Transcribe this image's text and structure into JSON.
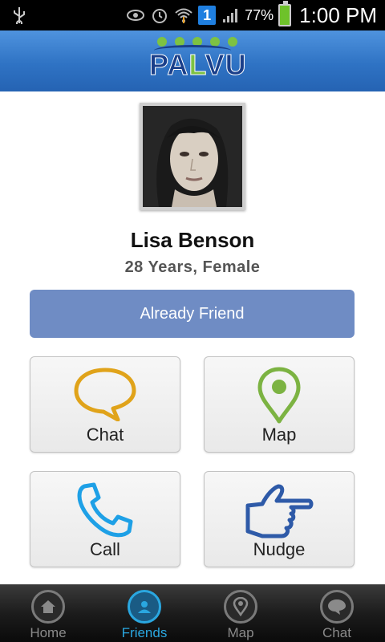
{
  "status_bar": {
    "battery_percent": "77%",
    "time": "1:00 PM",
    "notification_badge": "1"
  },
  "header": {
    "logo_text": "PALVU"
  },
  "profile": {
    "name": "Lisa Benson",
    "details": "28 Years, Female"
  },
  "friend_status_label": "Already Friend",
  "actions": {
    "chat": "Chat",
    "map": "Map",
    "call": "Call",
    "nudge": "Nudge"
  },
  "bottom_nav": {
    "home": "Home",
    "friends": "Friends",
    "map": "Map",
    "chat": "Chat"
  },
  "colors": {
    "header_blue": "#2f73c4",
    "friend_button": "#6f8cc4",
    "chat_icon": "#e0a31a",
    "map_icon": "#7cb342",
    "call_icon": "#1ea0e6",
    "nudge_icon": "#2e5aa8",
    "nav_active": "#2aa7e0"
  }
}
